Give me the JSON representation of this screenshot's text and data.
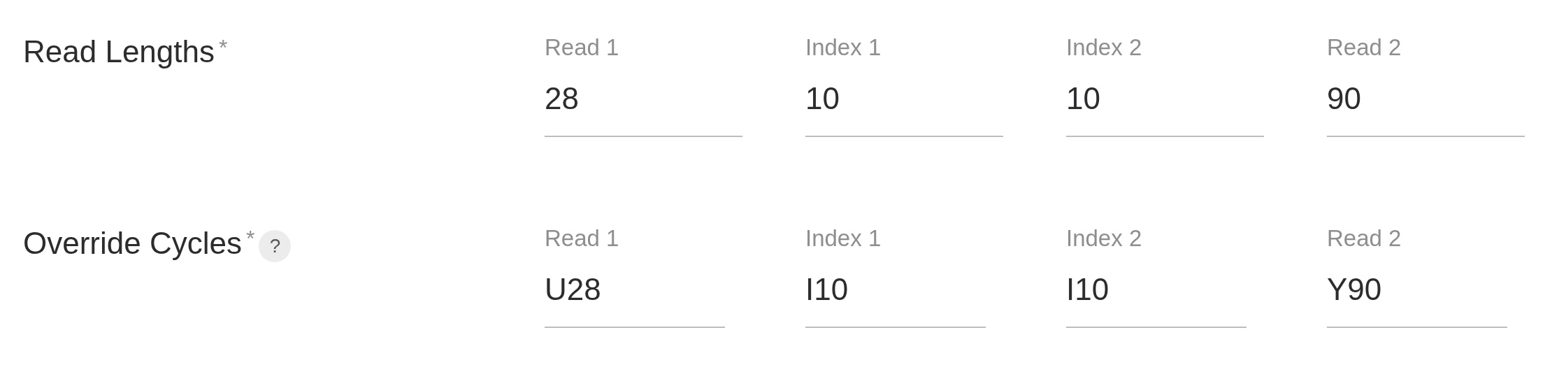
{
  "rows": [
    {
      "label": "Read Lengths",
      "required_mark": "*",
      "fields": [
        {
          "label": "Read 1",
          "value": "28"
        },
        {
          "label": "Index 1",
          "value": "10"
        },
        {
          "label": "Index 2",
          "value": "10"
        },
        {
          "label": "Read 2",
          "value": "90"
        }
      ]
    },
    {
      "label": "Override Cycles",
      "required_mark": "*",
      "help": "?",
      "fields": [
        {
          "label": "Read 1",
          "value": "U28"
        },
        {
          "label": "Index 1",
          "value": "I10"
        },
        {
          "label": "Index 2",
          "value": "I10"
        },
        {
          "label": "Read 2",
          "value": "Y90"
        }
      ]
    }
  ]
}
